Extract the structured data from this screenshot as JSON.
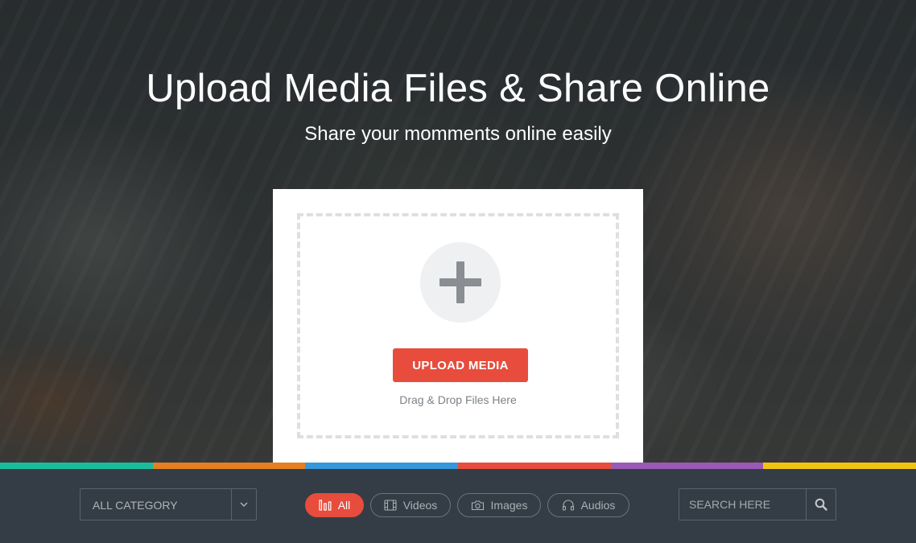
{
  "hero": {
    "title": "Upload Media Files & Share Online",
    "subtitle": "Share your momments online easily"
  },
  "upload": {
    "button_label": "UPLOAD MEDIA",
    "hint": "Drag & Drop Files Here",
    "add_icon": "plus-icon"
  },
  "stripe_colors": [
    "#1abc9c",
    "#e67e22",
    "#3498db",
    "#e74c3c",
    "#9b59b6",
    "#f1c40f"
  ],
  "filterbar": {
    "category": {
      "selected": "ALL CATEGORY",
      "toggle_icon": "chevron-down-icon"
    },
    "filters": [
      {
        "label": "All",
        "icon": "bar-chart-icon",
        "active": true
      },
      {
        "label": "Videos",
        "icon": "film-icon",
        "active": false
      },
      {
        "label": "Images",
        "icon": "camera-icon",
        "active": false
      },
      {
        "label": "Audios",
        "icon": "headphones-icon",
        "active": false
      }
    ],
    "search": {
      "placeholder": "SEARCH HERE",
      "icon": "search-icon"
    }
  },
  "colors": {
    "accent": "#e74c3c",
    "bar_background": "#343d45"
  }
}
